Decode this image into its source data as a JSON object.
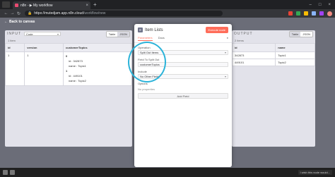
{
  "browser": {
    "tab_title": "n8n - ▶ My workflow",
    "tab_close": "×",
    "new_tab": "+",
    "url_host": "https://mutedjam.app.n8n.cloud",
    "url_path": "/workflow/new",
    "window_controls": [
      "–",
      "□",
      "×"
    ],
    "nav": [
      "←",
      "→",
      "↻"
    ]
  },
  "app": {
    "back_label": "Back to canvas",
    "input_panel": {
      "label": "INPUT",
      "node_select": "Code",
      "view_options": [
        "Table",
        "JSON"
      ],
      "active_view": "JSON",
      "items_count": "1 item",
      "columns": [
        "id",
        "version",
        "customerTopics"
      ],
      "row": {
        "id": "1",
        "version": "1",
        "topics": [
          {
            "index": "0",
            "id_key": "id",
            "id_val": "342873",
            "name_key": "name",
            "name_val": "Topic1"
          },
          {
            "index": "1",
            "id_key": "id",
            "id_val": "449101",
            "name_key": "name",
            "name_val": "Topic2"
          }
        ]
      }
    },
    "modal": {
      "title": "Item Lists",
      "execute_label": "Execute node",
      "tabs": [
        "Parameters",
        "Docs"
      ],
      "active_tab": "Parameters",
      "operation_label": "Operation",
      "operation_value": "Split Out Items",
      "field_label": "Field To Split Out",
      "field_value": "customerTopics",
      "include_label": "Include",
      "include_value": "No Other Fields",
      "options_label": "Options",
      "no_properties": "No properties",
      "add_field_label": "Add Field"
    },
    "output_panel": {
      "label": "OUTPUT",
      "view_options": [
        "Table",
        "JSON"
      ],
      "active_view": "Table",
      "items_count": "2 items",
      "columns": [
        "id",
        "name"
      ],
      "rows": [
        {
          "id": "342873",
          "name": "Topic1"
        },
        {
          "id": "449101",
          "name": "Topic2"
        }
      ]
    }
  },
  "taskbar": {
    "notification": "I wish this node would..."
  }
}
